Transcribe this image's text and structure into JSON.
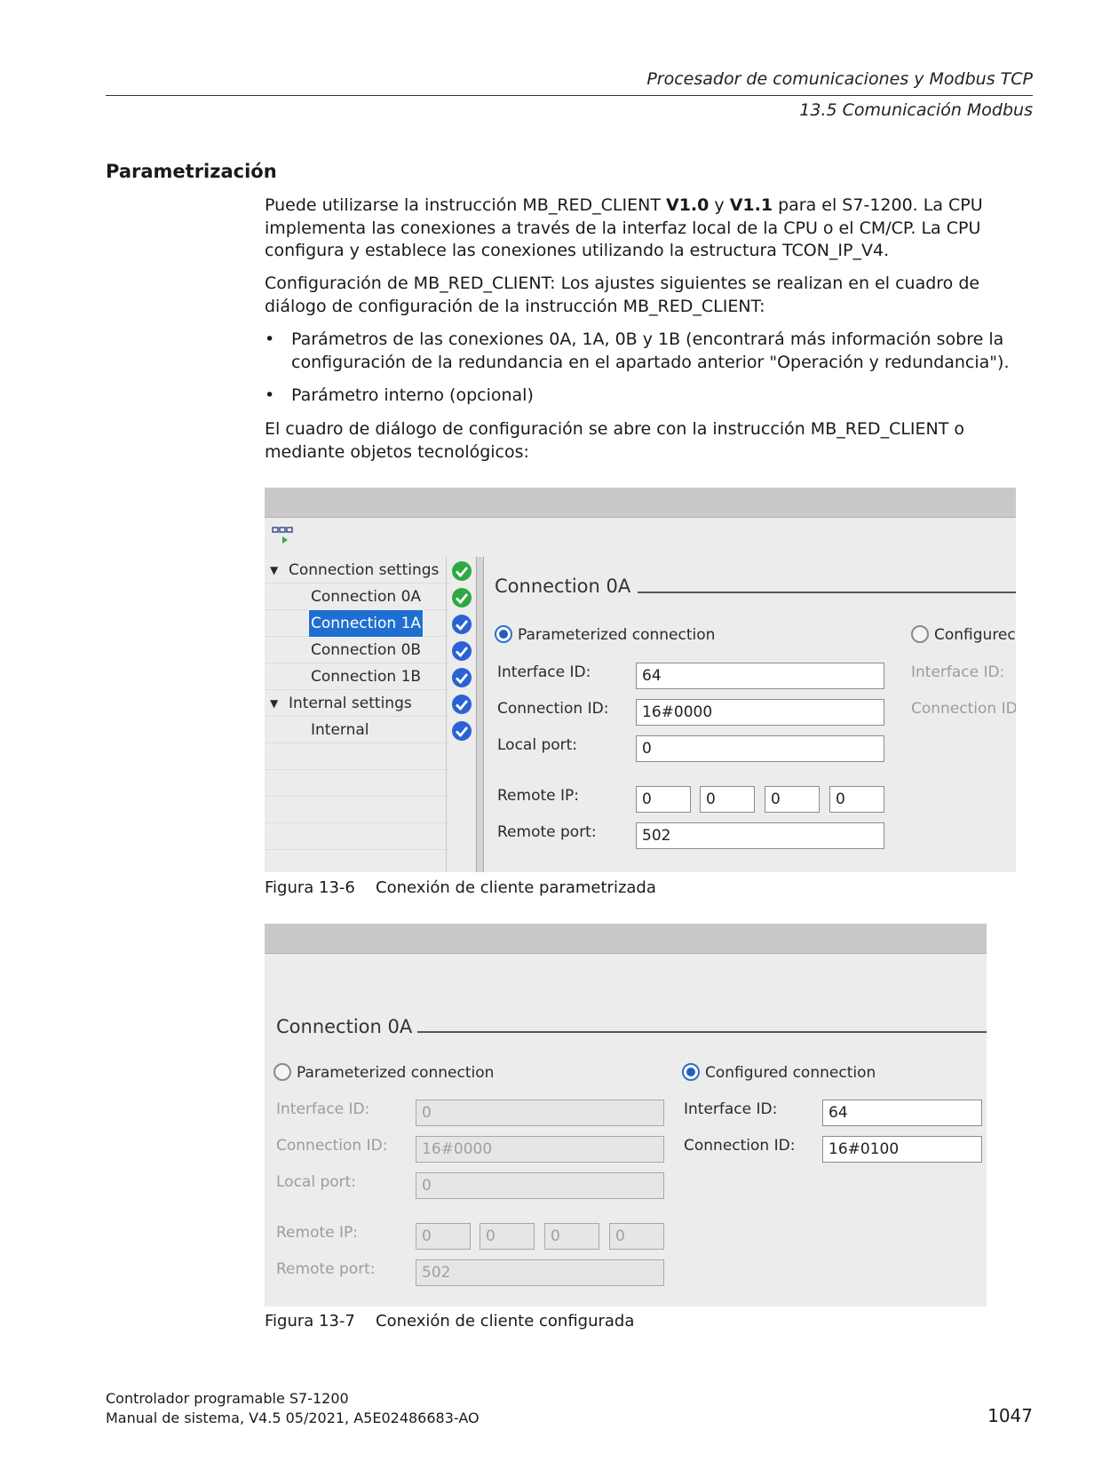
{
  "header": {
    "chapter": "Procesador de comunicaciones y Modbus TCP",
    "section": "13.5 Comunicación Modbus"
  },
  "section_title": "Parametrización",
  "paragraphs": {
    "p1_a": "Puede utilizarse la instrucción MB_RED_CLIENT ",
    "p1_b1": "V1.0",
    "p1_c": " y ",
    "p1_b2": "V1.1",
    "p1_d": " para el S7-1200. La CPU implementa las conexiones a través de la interfaz local de la CPU o el CM/CP. La CPU configura y establece las conexiones utilizando la estructura TCON_IP_V4.",
    "p2": "Configuración de MB_RED_CLIENT: Los ajustes siguientes se realizan en el cuadro de diálogo de configuración de la instrucción MB_RED_CLIENT:",
    "bullets": [
      "Parámetros de las conexiones 0A, 1A, 0B y 1B (encontrará más información sobre la configuración de la redundancia en el apartado anterior \"Operación y redundancia\").",
      "Parámetro interno (opcional)"
    ],
    "p3": "El cuadro de diálogo de configuración se abre con la instrucción MB_RED_CLIENT o mediante objetos tecnológicos:"
  },
  "figure1": {
    "tree": [
      {
        "label": "Connection settings",
        "status": "green"
      },
      {
        "label": "Connection 0A",
        "status": "green"
      },
      {
        "label": "Connection 1A",
        "status": "blue"
      },
      {
        "label": "Connection 0B",
        "status": "blue"
      },
      {
        "label": "Connection 1B",
        "status": "blue"
      },
      {
        "label": "Internal settings",
        "status": "blue"
      },
      {
        "label": "Internal",
        "status": "blue"
      }
    ],
    "section_title": "Connection 0A",
    "radio_param": "Parameterized connection",
    "radio_conf": "Configurec",
    "labels": {
      "interface_id": "Interface ID:",
      "connection_id": "Connection ID:",
      "local_port": "Local port:",
      "remote_ip": "Remote IP:",
      "remote_port": "Remote port:",
      "interface_id_right": "Interface ID:",
      "connection_id_right": "Connection ID"
    },
    "values": {
      "interface_id": "64",
      "connection_id": "16#0000",
      "local_port": "0",
      "ip1": "0",
      "ip2": "0",
      "ip3": "0",
      "ip4": "0",
      "remote_port": "502"
    },
    "colors": {
      "check_green": "#2fa843",
      "check_blue": "#2a62d4",
      "selection": "#1f6fd1"
    }
  },
  "caption1": {
    "number": "Figura 13-6",
    "text": "Conexión de cliente parametrizada"
  },
  "figure2": {
    "section_title": "Connection 0A",
    "radio_param": "Parameterized connection",
    "radio_conf": "Configured connection",
    "labels": {
      "interface_id": "Interface ID:",
      "connection_id": "Connection ID:",
      "local_port": "Local port:",
      "remote_ip": "Remote IP:",
      "remote_port": "Remote port:",
      "interface_id_right": "Interface ID:",
      "connection_id_right": "Connection ID:"
    },
    "values": {
      "interface_id": "0",
      "connection_id": "16#0000",
      "local_port": "0",
      "ip1": "0",
      "ip2": "0",
      "ip3": "0",
      "ip4": "0",
      "remote_port": "502",
      "interface_id_right": "64",
      "connection_id_right": "16#0100"
    }
  },
  "caption2": {
    "number": "Figura 13-7",
    "text": "Conexión de cliente configurada"
  },
  "footer": {
    "line1": "Controlador programable S7-1200",
    "line2": "Manual de sistema, V4.5 05/2021, A5E02486683-AO",
    "page": "1047"
  }
}
